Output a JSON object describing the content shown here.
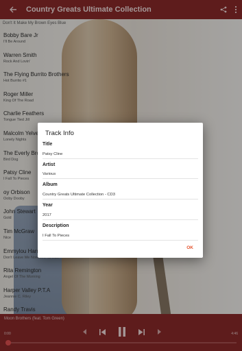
{
  "colors": {
    "toolbar": "#8b2a2a",
    "accent": "#e5532d",
    "scrim": "rgba(0,0,0,0.32)"
  },
  "toolbar": {
    "title": "Country Greats Ultimate Collection",
    "back_icon": "arrow-left-icon",
    "share_icon": "share-icon",
    "more_icon": "more-vert-icon"
  },
  "subheader": {
    "text": "Don't It Make My Brown Eyes Blue"
  },
  "songs": [
    {
      "title": "Bobby Bare Jr",
      "subtitle": "I'll Be Around"
    },
    {
      "title": "Warren Smith",
      "subtitle": "Rock And Lovin'"
    },
    {
      "title": "The Flying Burrito Brothers",
      "subtitle": "Hot Burrito #1"
    },
    {
      "title": "Roger Miller",
      "subtitle": "King Of The Road"
    },
    {
      "title": "Charlie Feathers",
      "subtitle": "Tongue Tied Jill"
    },
    {
      "title": "Malcolm Yelvet",
      "subtitle": "Lonely Nights"
    },
    {
      "title": "The Everly Broth",
      "subtitle": "Bird Dog"
    },
    {
      "title": "Patsy Cline",
      "subtitle": "I Fall To Pieces"
    },
    {
      "title": "oy Orbison",
      "subtitle": "Ooby Dooby"
    },
    {
      "title": "John Stewart",
      "subtitle": "Gold"
    },
    {
      "title": "Tim McGraw",
      "subtitle": "Nice"
    },
    {
      "title": "Emmylou Harri",
      "subtitle": "Don't Leave Me Nowhere To Run"
    },
    {
      "title": "Rita Remington",
      "subtitle": "Angel Of The Morning"
    },
    {
      "title": "Harper Valley P.T.A",
      "subtitle": "Jeannie C. Riley"
    },
    {
      "title": "Randy Travis",
      "subtitle": ""
    }
  ],
  "player": {
    "now_playing": "Moon Brothers (feat. Tom Green)",
    "time_elapsed": "0:00",
    "time_total": "4:46",
    "progress": 0.0
  },
  "dialog": {
    "title": "Track Info",
    "fields": [
      {
        "label": "Title",
        "value": "Patsy Cline"
      },
      {
        "label": "Artist",
        "value": "Various"
      },
      {
        "label": "Album",
        "value": "Country Greats Ultimate Collection - CD3"
      },
      {
        "label": "Year",
        "value": "2017"
      },
      {
        "label": "Description",
        "value": "I Fall To Pieces"
      }
    ],
    "ok_label": "OK"
  }
}
